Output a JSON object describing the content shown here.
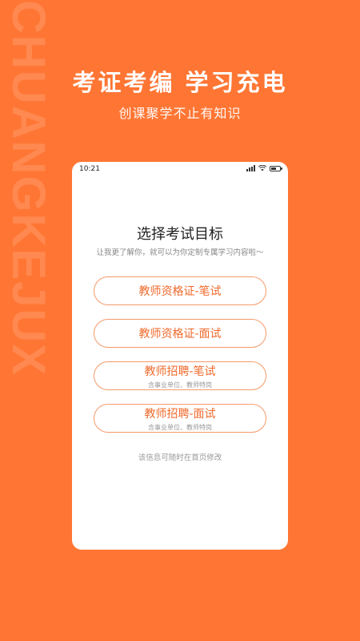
{
  "brand": {
    "vertical_text": "CHUANGKEJUX"
  },
  "hero": {
    "headline": "考证考编  学习充电",
    "subline": "创课聚学不止有知识"
  },
  "status_bar": {
    "time": "10:21"
  },
  "screen": {
    "title": "选择考试目标",
    "description": "让我更了解你，就可以为你定制专属学习内容啦～",
    "options": [
      {
        "label": "教师资格证-笔试",
        "sub": ""
      },
      {
        "label": "教师资格证-面试",
        "sub": ""
      },
      {
        "label": "教师招聘-笔试",
        "sub": "含事业单位、教师特岗"
      },
      {
        "label": "教师招聘-面试",
        "sub": "含事业单位、教师特岗"
      }
    ],
    "note": "该信息可随时在首页修改"
  },
  "colors": {
    "background": "#FF7634",
    "accent": "#F06A2B",
    "border": "#F49A6B"
  }
}
